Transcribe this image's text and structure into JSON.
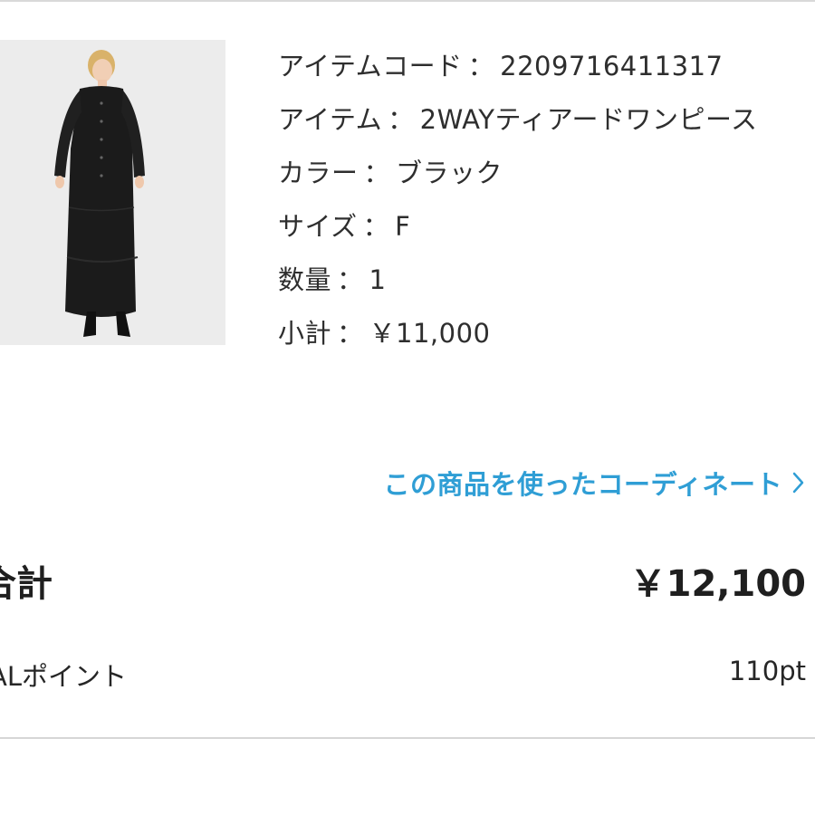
{
  "item": {
    "code_label": "アイテムコード",
    "code_value": "2209716411317",
    "name_label": "アイテム",
    "name_value": "2WAYティアードワンピース",
    "color_label": "カラー",
    "color_value": "ブラック",
    "size_label": "サイズ",
    "size_value": "F",
    "qty_label": "数量",
    "qty_value": "1",
    "subtotal_label": "小計",
    "subtotal_value": "￥11,000",
    "separator": "："
  },
  "coordinate_link": "この商品を使ったコーディネート",
  "total": {
    "label": "合計",
    "value": "￥12,100"
  },
  "points": {
    "label": "ALポイント",
    "value": "110pt"
  },
  "colors": {
    "link": "#2f9ed5",
    "text": "#2b2b2b"
  }
}
